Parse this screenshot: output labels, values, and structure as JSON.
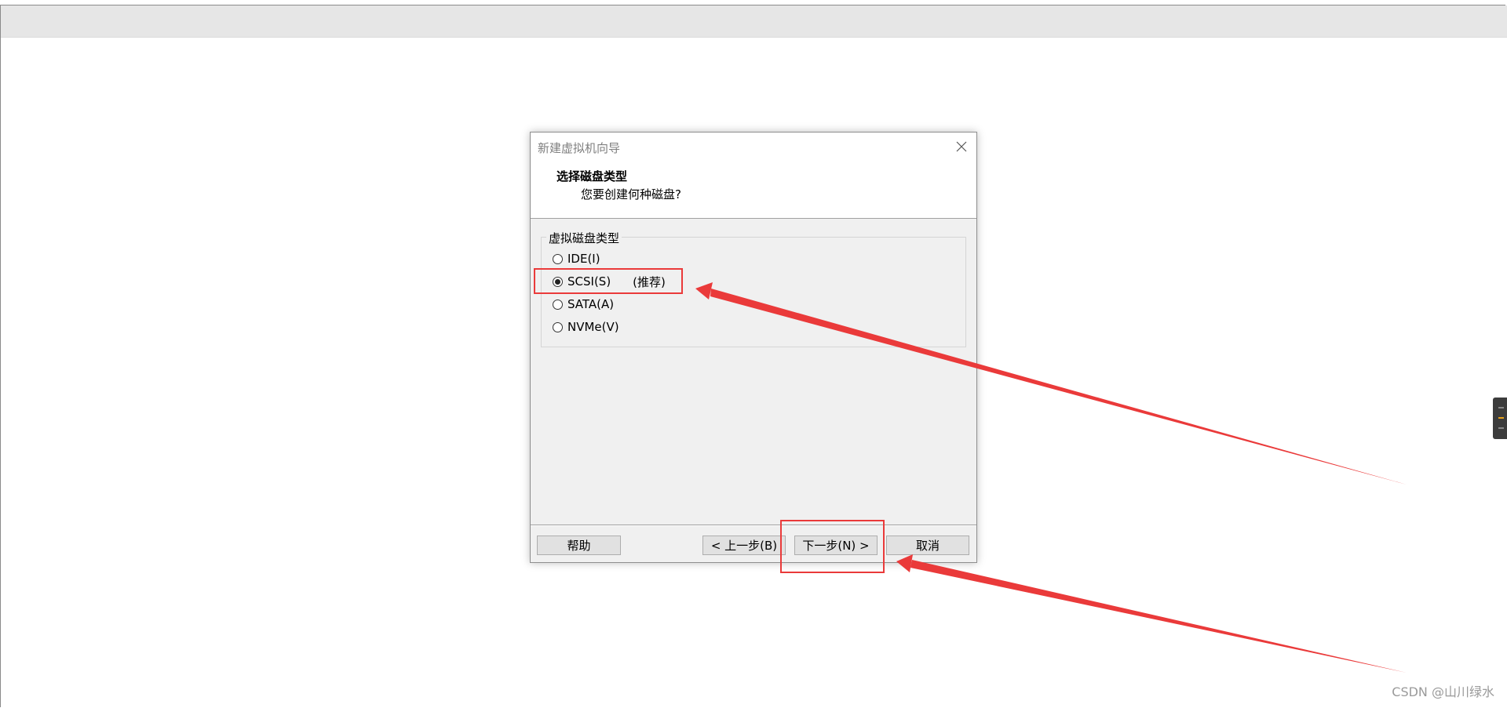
{
  "dialog": {
    "title": "新建虚拟机向导",
    "heading": "选择磁盘类型",
    "subheading": "您要创建何种磁盘?",
    "group_label": "虚拟磁盘类型",
    "options": [
      {
        "label": "IDE(I)",
        "checked": false,
        "note": ""
      },
      {
        "label": "SCSI(S)",
        "checked": true,
        "note": "(推荐)"
      },
      {
        "label": "SATA(A)",
        "checked": false,
        "note": ""
      },
      {
        "label": "NVMe(V)",
        "checked": false,
        "note": ""
      }
    ],
    "buttons": {
      "help": "帮助",
      "back": "< 上一步(B)",
      "next": "下一步(N) >",
      "cancel": "取消"
    }
  },
  "watermark": "CSDN @山川绿水",
  "colors": {
    "annotation": "#ea3a3a",
    "dialog_bg": "#f0f0f0",
    "topbar_bg": "#e6e6e6"
  },
  "icons": {
    "close": "close-icon",
    "annotation_arrow": "arrow-icon"
  }
}
